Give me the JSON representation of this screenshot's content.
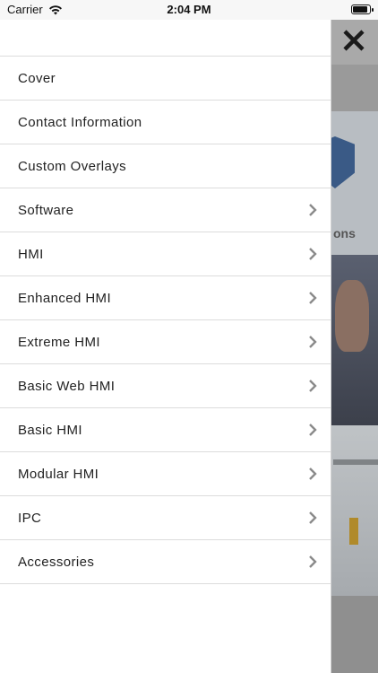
{
  "status_bar": {
    "carrier": "Carrier",
    "time": "2:04 PM",
    "icons": [
      "wifi-icon",
      "battery-icon"
    ]
  },
  "background": {
    "visible_text": "ons"
  },
  "close_button": {
    "icon": "close-icon"
  },
  "menu": {
    "items": [
      {
        "label": "Cover",
        "has_submenu": false
      },
      {
        "label": "Contact Information",
        "has_submenu": false
      },
      {
        "label": "Custom Overlays",
        "has_submenu": false
      },
      {
        "label": "Software",
        "has_submenu": true
      },
      {
        "label": "HMI",
        "has_submenu": true
      },
      {
        "label": "Enhanced HMI",
        "has_submenu": true
      },
      {
        "label": "Extreme HMI",
        "has_submenu": true
      },
      {
        "label": "Basic Web HMI",
        "has_submenu": true
      },
      {
        "label": "Basic HMI",
        "has_submenu": true
      },
      {
        "label": "Modular HMI",
        "has_submenu": true
      },
      {
        "label": "IPC",
        "has_submenu": true
      },
      {
        "label": "Accessories",
        "has_submenu": true
      }
    ]
  },
  "colors": {
    "overlay": "#8f8f8f",
    "text": "#222222",
    "divider": "#dcdcdc",
    "chevron": "#8a8a8a"
  }
}
